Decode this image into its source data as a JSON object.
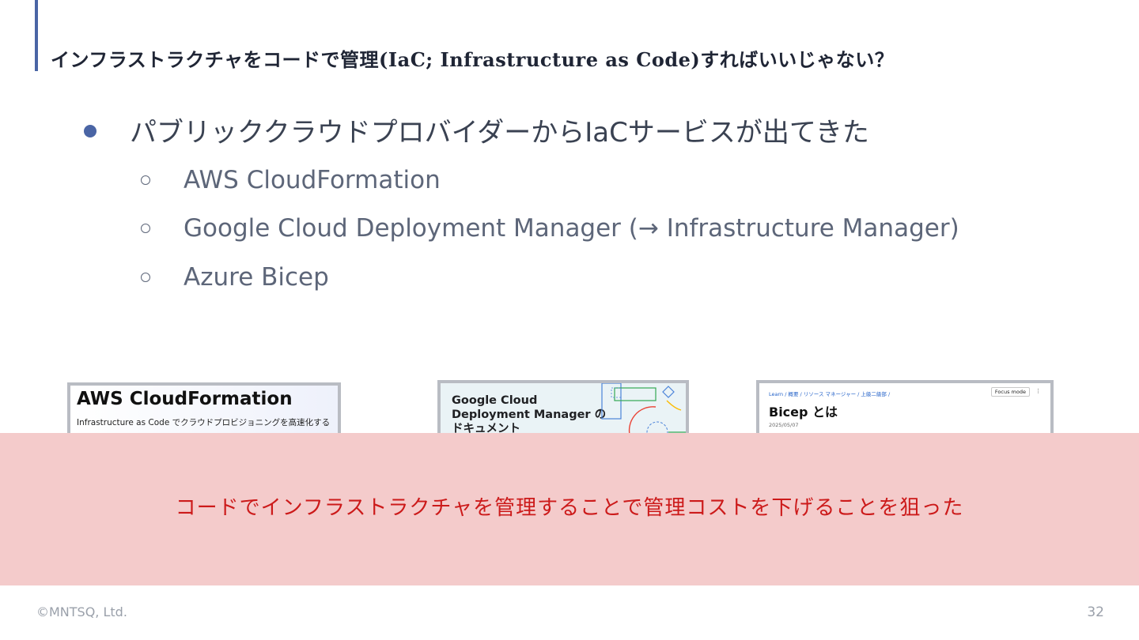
{
  "slide": {
    "title": "インフラストラクチャをコードで管理(IaC; Infrastructure as Code)すればいいじゃない？",
    "bullet_main": "パブリッククラウドプロバイダーからIaCサービスが出てきた",
    "sub_bullets": [
      "AWS CloudFormation",
      "Google Cloud Deployment Manager (→ Infrastructure Manager)",
      "Azure Bicep"
    ],
    "banner_text": "コードでインフラストラクチャを管理することで管理コストを下げることを狙った",
    "footer_copyright": "©MNTSQ, Ltd.",
    "page_number": "32"
  },
  "screenshots": {
    "aws": {
      "heading": "AWS CloudFormation",
      "subheading": "Infrastructure as Code でクラウドプロビジョニングを高速化する"
    },
    "gcp": {
      "heading_line1": "Google Cloud",
      "heading_line2": "Deployment Manager の",
      "heading_line3": "ドキュメント"
    },
    "azure": {
      "breadcrumb": "Learn  /  概要  /  リソース マネージャー  /  上級二級部  /",
      "focus_label": "Focus mode",
      "more": "⋮",
      "heading": "Bicep とは",
      "date": "2025/05/07"
    }
  },
  "colors": {
    "accent": "#4a65a5",
    "banner_bg": "#f4cbcb",
    "banner_text": "#cc1a1a"
  }
}
